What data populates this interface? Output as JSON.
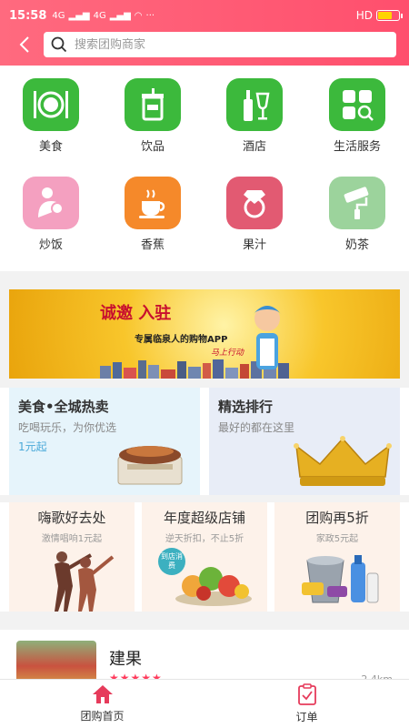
{
  "status_bar": {
    "time": "15:58",
    "signal1": "4G",
    "signal2": "4G",
    "more": "···",
    "right_text": "HD"
  },
  "search": {
    "placeholder": "搜索团购商家"
  },
  "categories": [
    {
      "label": "美食",
      "icon": "plate-cutlery-icon",
      "color": "#3cb93c"
    },
    {
      "label": "饮品",
      "icon": "cup-icon",
      "color": "#3cb93c"
    },
    {
      "label": "酒店",
      "icon": "wine-bottle-icon",
      "color": "#3cb93c"
    },
    {
      "label": "生活服务",
      "icon": "grid-search-icon",
      "color": "#3cb93c"
    },
    {
      "label": "炒饭",
      "icon": "mother-baby-icon",
      "color": "#f4a0c0"
    },
    {
      "label": "香蕉",
      "icon": "coffee-cup-icon",
      "color": "#f5892a"
    },
    {
      "label": "果汁",
      "icon": "diamond-ring-icon",
      "color": "#e25a72"
    },
    {
      "label": "奶茶",
      "icon": "paint-roller-icon",
      "color": "#9cd39c"
    }
  ],
  "banner": {
    "line1": "诚邀 入驻",
    "line2": "专属临泉人的购物APP",
    "line3": "马上行动"
  },
  "promo_two": [
    {
      "title": "美食•全城热卖",
      "subtitle": "吃喝玩乐，为你优选",
      "extra": "1元起"
    },
    {
      "title": "精选排行",
      "subtitle": "最好的都在这里"
    }
  ],
  "promo_three": [
    {
      "title": "嗨歌好去处",
      "subtitle": "激情唱响1元起"
    },
    {
      "title": "年度超级店铺",
      "subtitle": "逆天折扣，不止5折",
      "badge": "到店消费"
    },
    {
      "title": "团购再5折",
      "subtitle": "家政5元起"
    }
  ],
  "shop": {
    "name": "建果",
    "stars": "★★★★★",
    "rating": 5,
    "distance": "2.4km"
  },
  "tabs": [
    {
      "label": "团购首页",
      "icon": "home-icon",
      "active": true
    },
    {
      "label": "订单",
      "icon": "order-clipboard-icon",
      "active": false
    }
  ],
  "colors": {
    "brand": "#ff4f6d",
    "active_tab": "#e63b5b"
  }
}
